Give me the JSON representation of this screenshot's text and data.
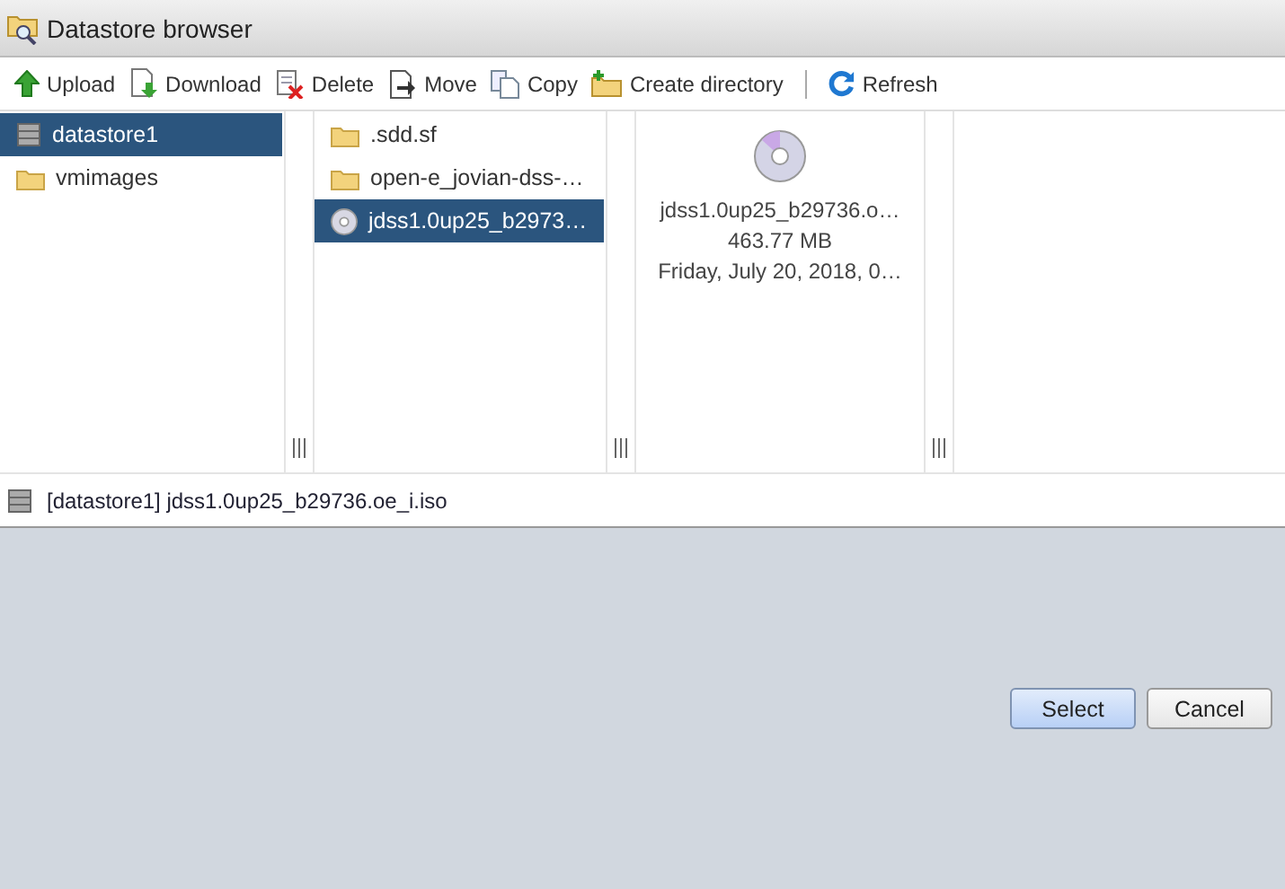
{
  "window": {
    "title": "Datastore browser"
  },
  "toolbar": [
    {
      "label": "Upload",
      "kind": "upload"
    },
    {
      "label": "Download",
      "kind": "download"
    },
    {
      "label": "Delete",
      "kind": "delete"
    },
    {
      "label": "Move",
      "kind": "move"
    },
    {
      "label": "Copy",
      "kind": "copy"
    },
    {
      "label": "Create directory",
      "kind": "mkdir"
    },
    {
      "label": "Refresh",
      "kind": "refresh"
    }
  ],
  "columns": [
    {
      "items": [
        {
          "label": "datastore1",
          "kind": "datastore",
          "selected": true
        },
        {
          "label": "vmimages",
          "kind": "folder",
          "selected": false
        }
      ]
    },
    {
      "items": [
        {
          "label": ".sdd.sf",
          "kind": "folder",
          "selected": false
        },
        {
          "label": "open-e_jovian-dss-…",
          "kind": "folder",
          "selected": false
        },
        {
          "label": "jdss1.0up25_b2973…",
          "kind": "disc",
          "selected": true
        }
      ]
    }
  ],
  "preview": {
    "name": "jdss1.0up25_b29736.o…",
    "size": "463.77 MB",
    "date": "Friday, July 20, 2018, 0…"
  },
  "path": "[datastore1] jdss1.0up25_b29736.oe_i.iso",
  "buttons": [
    {
      "label": "Select",
      "selected": true
    },
    {
      "label": "Cancel",
      "selected": false
    }
  ]
}
